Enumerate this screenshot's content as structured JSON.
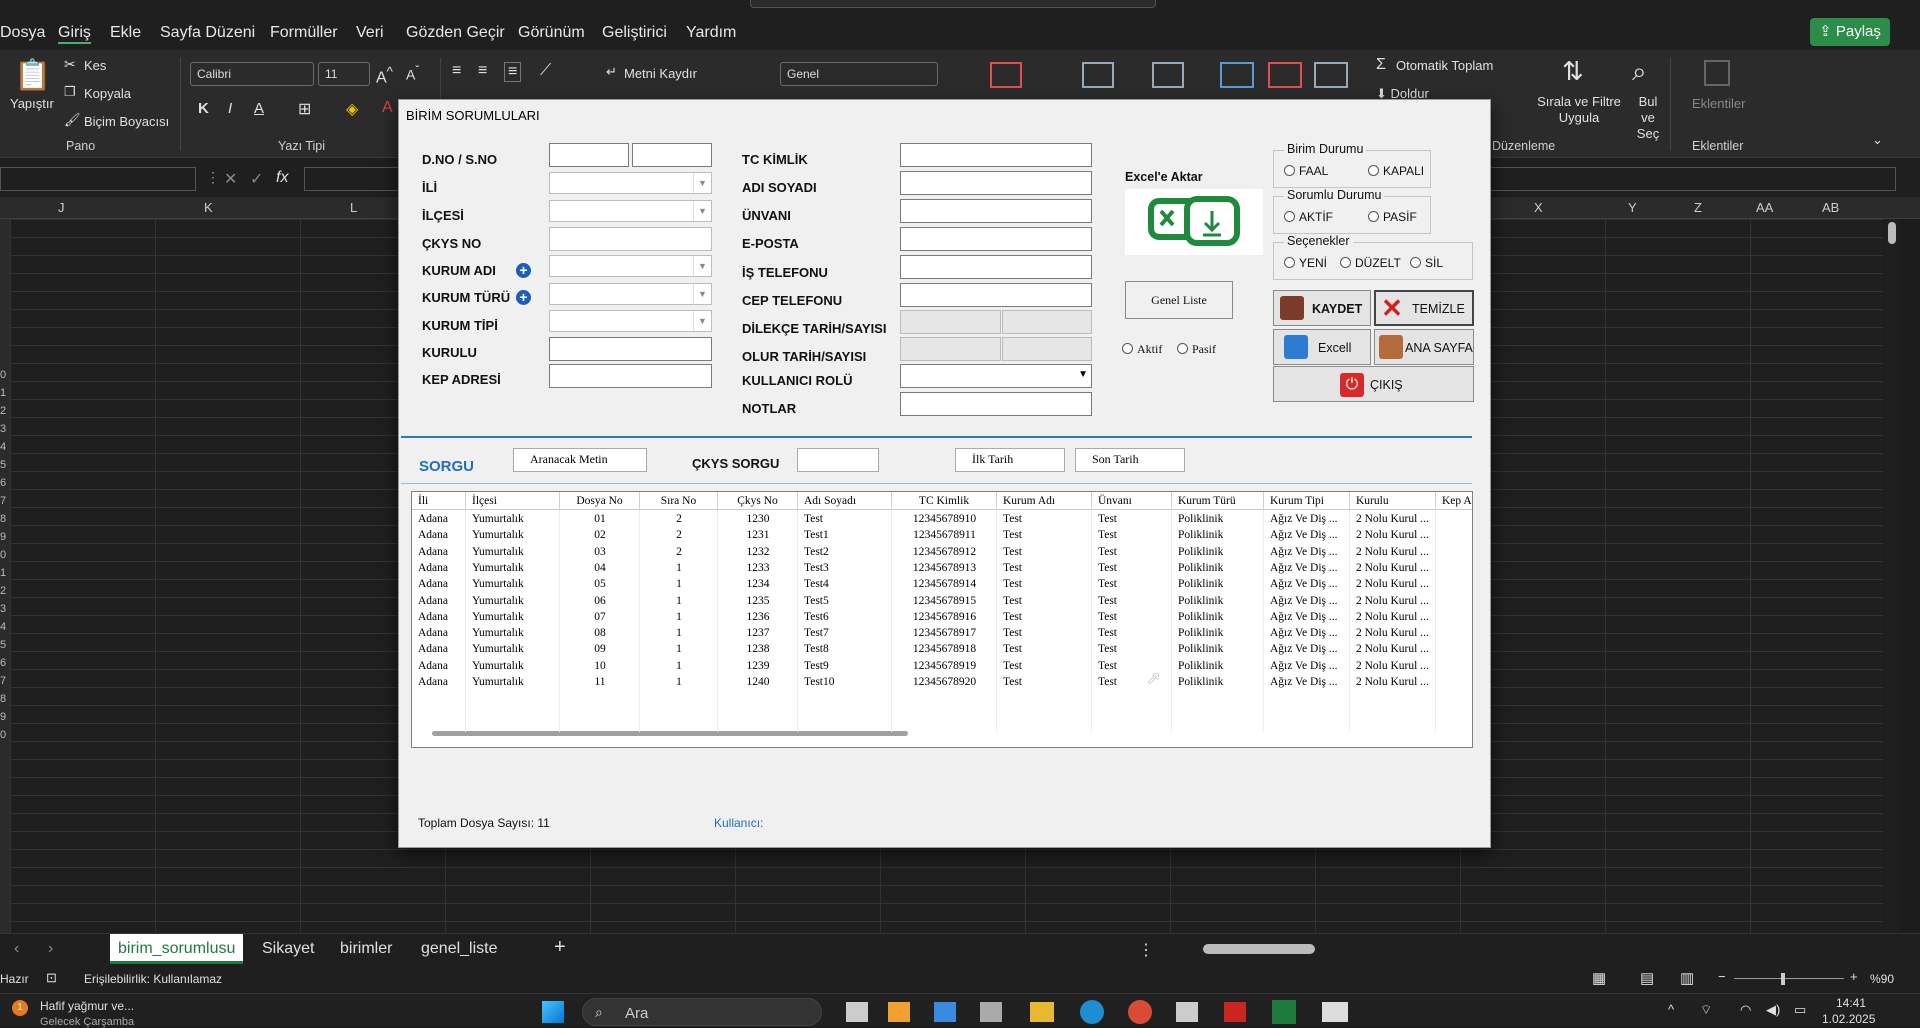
{
  "menu": [
    "Dosya",
    "Giriş",
    "Ekle",
    "Sayfa Düzeni",
    "Formüller",
    "Veri",
    "Gözden Geçir",
    "Görünüm",
    "Geliştirici",
    "Yardım"
  ],
  "share_label": "Paylaş",
  "ribbon": {
    "paste": "Yapıştır",
    "cut": "Kes",
    "copy": "Kopyala",
    "format_painter": "Biçim Boyacısı",
    "group_clipboard": "Pano",
    "font_name": "Calibri",
    "font_size": "11",
    "bold": "K",
    "italic": "I",
    "underline": "A",
    "group_font": "Yazı Tipi",
    "wrap_text": "Metni Kaydır",
    "number_format": "Genel",
    "autosum": "Otomatik Toplam",
    "fill": "Doldur",
    "sort_filter": "Sırala ve Filtre Uygula",
    "find_select": "Bul ve Seç",
    "group_editing": "Düzenleme",
    "addins": "Eklentiler",
    "group_addins": "Eklentiler"
  },
  "column_headers": [
    "J",
    "K",
    "L",
    "X",
    "Y",
    "Z",
    "AA",
    "AB"
  ],
  "row_numbers": [
    "0",
    "1",
    "2",
    "3",
    "4",
    "5",
    "6",
    "7",
    "8",
    "9",
    "0",
    "1",
    "2",
    "3",
    "4",
    "5",
    "6",
    "7",
    "8",
    "9",
    "0"
  ],
  "sheet_tabs": [
    "birim_sorumlusu",
    "Sikayet",
    "birimler",
    "genel_liste"
  ],
  "status": {
    "ready": "Hazır",
    "accessibility": "Erişilebilirlik: Kullanılamaz",
    "zoom": "%90"
  },
  "taskbar": {
    "weather": "Hafif yağmur ve...",
    "weather_sub": "Gelecek Çarşamba",
    "search": "Ara",
    "time": "14:41",
    "date": "1.02.2025",
    "badge": "1"
  },
  "dialog": {
    "title": "BİRİM SORUMLULARI",
    "left_labels": [
      "D.NO / S.NO",
      "İLİ",
      "İLÇESİ",
      "ÇKYS NO",
      "KURUM ADI",
      "KURUM TÜRÜ",
      "KURUM TİPİ",
      "KURULU",
      "KEP ADRESİ"
    ],
    "mid_labels": [
      "TC KİMLİK",
      "ADI SOYADI",
      "ÜNVANI",
      "E-POSTA",
      "İŞ TELEFONU",
      "CEP TELEFONU",
      "DİLEKÇE TARİH/SAYISI",
      "OLUR TARİH/SAYISI",
      "KULLANICI ROLÜ",
      "NOTLAR"
    ],
    "excel_export": "Excel'e Aktar",
    "general_list": "Genel Liste",
    "radio_active": "Aktif",
    "radio_passive": "Pasif",
    "unit_status": {
      "legend": "Birim Durumu",
      "opt1": "FAAL",
      "opt2": "KAPALI"
    },
    "resp_status": {
      "legend": "Sorumlu Durumu",
      "opt1": "AKTİF",
      "opt2": "PASİF"
    },
    "options": {
      "legend": "Seçenekler",
      "opt1": "YENİ",
      "opt2": "DÜZELT",
      "opt3": "SİL"
    },
    "btn_save": "KAYDET",
    "btn_clear": "TEMİZLE",
    "btn_excel": "Excell",
    "btn_home": "ANA SAYFA",
    "btn_exit": "ÇIKIŞ",
    "query_title": "SORGU",
    "search_placeholder": "Aranacak Metin",
    "ckys_query": "ÇKYS SORGU",
    "first_date": "İlk Tarih",
    "last_date": "Son Tarih",
    "total_label": "Toplam Dosya Sayısı: 11",
    "user_label": "Kullanıcı:",
    "columns": [
      "İli",
      "İlçesi",
      "Dosya No",
      "Sıra No",
      "Çkys No",
      "Adı Soyadı",
      "TC Kimlik",
      "Kurum Adı",
      "Ünvanı",
      "Kurum Türü",
      "Kurum Tipi",
      "Kurulu",
      "Kep A"
    ],
    "rows": [
      [
        "Adana",
        "Yumurtalık",
        "01",
        "2",
        "1230",
        "Test",
        "12345678910",
        "Test",
        "Test",
        "Poliklinik",
        "Ağız Ve Diş ...",
        "2 Nolu Kurul ...",
        ""
      ],
      [
        "Adana",
        "Yumurtalık",
        "02",
        "2",
        "1231",
        "Test1",
        "12345678911",
        "Test",
        "Test",
        "Poliklinik",
        "Ağız Ve Diş ...",
        "2 Nolu Kurul ...",
        ""
      ],
      [
        "Adana",
        "Yumurtalık",
        "03",
        "2",
        "1232",
        "Test2",
        "12345678912",
        "Test",
        "Test",
        "Poliklinik",
        "Ağız Ve Diş ...",
        "2 Nolu Kurul ...",
        ""
      ],
      [
        "Adana",
        "Yumurtalık",
        "04",
        "1",
        "1233",
        "Test3",
        "12345678913",
        "Test",
        "Test",
        "Poliklinik",
        "Ağız Ve Diş ...",
        "2 Nolu Kurul ...",
        ""
      ],
      [
        "Adana",
        "Yumurtalık",
        "05",
        "1",
        "1234",
        "Test4",
        "12345678914",
        "Test",
        "Test",
        "Poliklinik",
        "Ağız Ve Diş ...",
        "2 Nolu Kurul ...",
        ""
      ],
      [
        "Adana",
        "Yumurtalık",
        "06",
        "1",
        "1235",
        "Test5",
        "12345678915",
        "Test",
        "Test",
        "Poliklinik",
        "Ağız Ve Diş ...",
        "2 Nolu Kurul ...",
        ""
      ],
      [
        "Adana",
        "Yumurtalık",
        "07",
        "1",
        "1236",
        "Test6",
        "12345678916",
        "Test",
        "Test",
        "Poliklinik",
        "Ağız Ve Diş ...",
        "2 Nolu Kurul ...",
        ""
      ],
      [
        "Adana",
        "Yumurtalık",
        "08",
        "1",
        "1237",
        "Test7",
        "12345678917",
        "Test",
        "Test",
        "Poliklinik",
        "Ağız Ve Diş ...",
        "2 Nolu Kurul ...",
        ""
      ],
      [
        "Adana",
        "Yumurtalık",
        "09",
        "1",
        "1238",
        "Test8",
        "12345678918",
        "Test",
        "Test",
        "Poliklinik",
        "Ağız Ve Diş ...",
        "2 Nolu Kurul ...",
        ""
      ],
      [
        "Adana",
        "Yumurtalık",
        "10",
        "1",
        "1239",
        "Test9",
        "12345678919",
        "Test",
        "Test",
        "Poliklinik",
        "Ağız Ve Diş ...",
        "2 Nolu Kurul ...",
        ""
      ],
      [
        "Adana",
        "Yumurtalık",
        "11",
        "1",
        "1240",
        "Test10",
        "12345678920",
        "Test",
        "Test",
        "Poliklinik",
        "Ağız Ve Diş ...",
        "2 Nolu Kurul ...",
        ""
      ]
    ]
  }
}
